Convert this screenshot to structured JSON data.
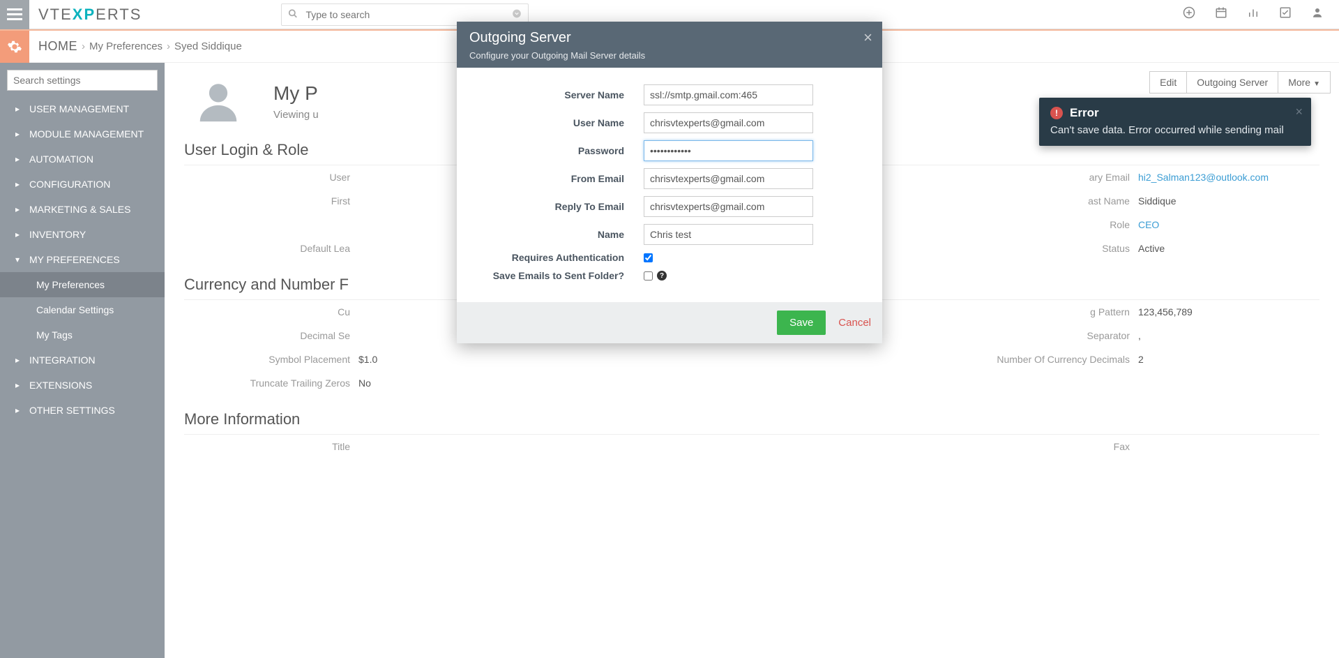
{
  "header": {
    "search_placeholder": "Type to search",
    "logo_pre": "VTE",
    "logo_mid": "XP",
    "logo_post": "ERTS"
  },
  "breadcrumb": {
    "home": "HOME",
    "l1": "My Preferences",
    "l2": "Syed Siddique"
  },
  "sidebar": {
    "search_placeholder": "Search settings",
    "items": [
      {
        "label": "USER MANAGEMENT"
      },
      {
        "label": "MODULE MANAGEMENT"
      },
      {
        "label": "AUTOMATION"
      },
      {
        "label": "CONFIGURATION"
      },
      {
        "label": "MARKETING & SALES"
      },
      {
        "label": "INVENTORY"
      },
      {
        "label": "MY PREFERENCES",
        "open": true,
        "subs": [
          {
            "label": "My Preferences",
            "active": true
          },
          {
            "label": "Calendar Settings"
          },
          {
            "label": "My Tags"
          }
        ]
      },
      {
        "label": "INTEGRATION"
      },
      {
        "label": "EXTENSIONS"
      },
      {
        "label": "OTHER SETTINGS"
      }
    ]
  },
  "page": {
    "title": "My P",
    "subtitle": "Viewing u",
    "actions": {
      "edit": "Edit",
      "outgoing": "Outgoing Server",
      "more": "More"
    }
  },
  "sections": {
    "login_role": {
      "title": "User Login & Role",
      "rows": [
        [
          "User",
          "",
          "",
          "",
          "ary Email",
          "hi2_Salman123@outlook.com"
        ],
        [
          "First",
          "",
          "",
          "",
          "ast Name",
          "Siddique"
        ],
        [
          "",
          "",
          "",
          "",
          "Role",
          "CEO"
        ],
        [
          "Default Lea",
          "",
          "",
          "",
          "Status",
          "Active"
        ]
      ]
    },
    "currency": {
      "title": "Currency and Number F",
      "rows": [
        [
          "Cu",
          "",
          "",
          "",
          "g Pattern",
          "123,456,789"
        ],
        [
          "Decimal Se",
          "",
          "",
          "",
          "Separator",
          ","
        ],
        [
          "Symbol Placement",
          "$1.0",
          "",
          "",
          "Number Of Currency Decimals",
          "2"
        ],
        [
          "Truncate Trailing Zeros",
          "No",
          "",
          "",
          "",
          ""
        ]
      ]
    },
    "more_info": {
      "title": "More Information",
      "rows": [
        [
          "Title",
          "",
          "",
          "",
          "Fax",
          ""
        ]
      ]
    }
  },
  "modal": {
    "title": "Outgoing Server",
    "subtitle": "Configure your Outgoing Mail Server details",
    "fields": {
      "server_name": {
        "label": "Server Name",
        "value": "ssl://smtp.gmail.com:465"
      },
      "user_name": {
        "label": "User Name",
        "value": "chrisvtexperts@gmail.com"
      },
      "password": {
        "label": "Password",
        "value": "••••••••••••"
      },
      "from_email": {
        "label": "From Email",
        "value": "chrisvtexperts@gmail.com"
      },
      "reply_to": {
        "label": "Reply To Email",
        "value": "chrisvtexperts@gmail.com"
      },
      "name": {
        "label": "Name",
        "value": "Chris test"
      },
      "requires_auth": {
        "label": "Requires Authentication",
        "checked": true
      },
      "save_sent": {
        "label": "Save Emails to Sent Folder?",
        "checked": false
      }
    },
    "save": "Save",
    "cancel": "Cancel"
  },
  "toast": {
    "title": "Error",
    "body": "Can't save data. Error occurred while sending mail"
  }
}
